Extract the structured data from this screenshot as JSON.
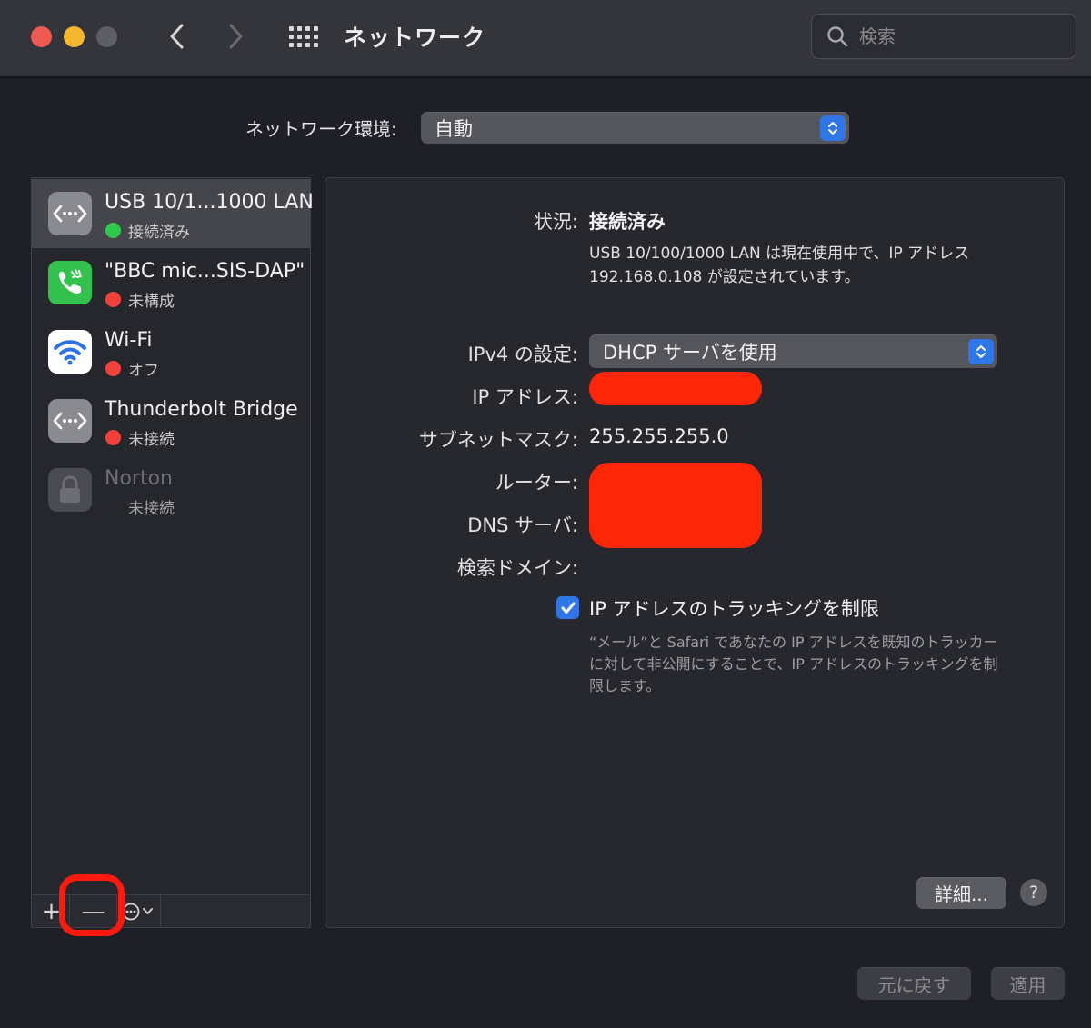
{
  "window": {
    "title": "ネットワーク",
    "search": {
      "placeholder": "検索",
      "value": ""
    }
  },
  "location": {
    "label": "ネットワーク環境:",
    "value": "自動"
  },
  "services": [
    {
      "name": "USB 10/1...1000 LAN",
      "status": "接続済み",
      "status_color": "#2fc94d",
      "icon": "ethernet-icon",
      "selected": true
    },
    {
      "name": "\"BBC mic...SIS-DAP\"",
      "status": "未構成",
      "status_color": "#f2413a",
      "icon": "phone-icon",
      "selected": false
    },
    {
      "name": "Wi-Fi",
      "status": "オフ",
      "status_color": "#f2413a",
      "icon": "wifi-icon",
      "selected": false
    },
    {
      "name": "Thunderbolt Bridge",
      "status": "未接続",
      "status_color": "#f2413a",
      "icon": "ethernet-icon",
      "selected": false
    },
    {
      "name": "Norton",
      "status": "未接続",
      "status_color": "",
      "icon": "lock-icon",
      "selected": false
    }
  ],
  "sidebar_toolbar": {
    "add": "+",
    "remove": "—"
  },
  "detail": {
    "status_label": "状況:",
    "status_value": "接続済み",
    "status_desc": "USB 10/100/1000 LAN は現在使用中で、IP アドレス 192.168.0.108 が設定されています。",
    "ipv4_label": "IPv4 の設定:",
    "ipv4_value": "DHCP サーバを使用",
    "ip_label": "IP アドレス:",
    "subnet_label": "サブネットマスク:",
    "subnet_value": "255.255.255.0",
    "router_label": "ルーター:",
    "dns_label": "DNS サーバ:",
    "search_domain_label": "検索ドメイン:",
    "limit_tracking_label": "IP アドレスのトラッキングを制限",
    "limit_tracking_checked": true,
    "limit_tracking_desc": "“メール”と Safari であなたの IP アドレスを既知のトラッカーに対して非公開にすることで、IP アドレスのトラッキングを制限します。",
    "advanced_button": "詳細...",
    "help_button": "?"
  },
  "footer": {
    "revert_button": "元に戻す",
    "apply_button": "適用"
  },
  "colors": {
    "accent": "#2f76e6",
    "redaction": "#fe2608",
    "highlight_ring": "#fe1a0f"
  }
}
